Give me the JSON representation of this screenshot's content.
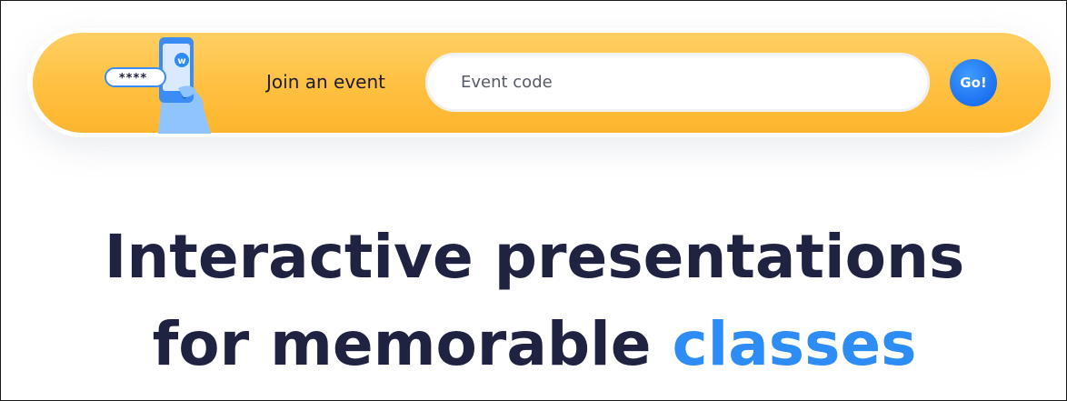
{
  "join_bar": {
    "illustration": {
      "masked_code": "****",
      "logo_letter": "w"
    },
    "label": "Join an event",
    "code_input": {
      "placeholder": "Event code",
      "value": ""
    },
    "go_label": "Go!"
  },
  "hero": {
    "line1": "Interactive presentations",
    "line2_prefix": "for memorable",
    "line2_highlight": "classes"
  },
  "colors": {
    "bar_yellow": "#ffc040",
    "accent_blue": "#2e8cf5",
    "heading_navy": "#1f2240",
    "go_blue": "#1d70f0"
  },
  "icons": [
    "phone-hand-icon",
    "password-field-icon"
  ]
}
